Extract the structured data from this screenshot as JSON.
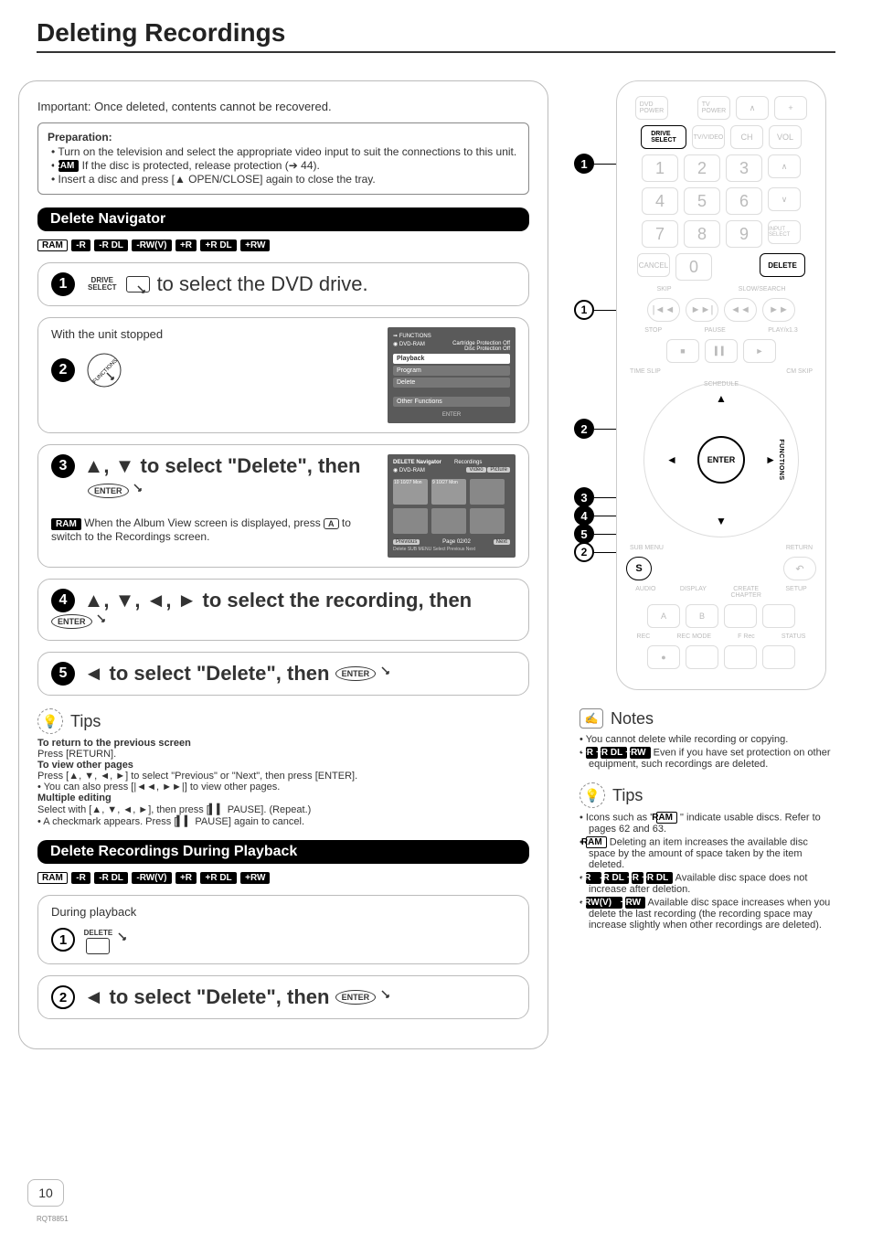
{
  "page": {
    "title": "Deleting Recordings",
    "number": "10",
    "doc_id": "RQT8851"
  },
  "intro": "Important: Once deleted, contents cannot be recovered.",
  "preparation": {
    "heading": "Preparation:",
    "items": [
      "Turn on the television and select the appropriate video input to suit the connections to this unit.",
      "If the disc is protected, release protection (➔ 44).",
      "Insert a disc and press [▲ OPEN/CLOSE] again to close the tray."
    ],
    "ram_chip": "RAM"
  },
  "section_delete_nav": {
    "title": "Delete Navigator",
    "chips": [
      "RAM",
      "-R",
      "-R DL",
      "-RW(V)",
      "+R",
      "+R DL",
      "+RW"
    ],
    "step1": {
      "drive_select_label": "DRIVE\nSELECT",
      "text": "to select the DVD drive."
    },
    "step2": {
      "text": "With the unit stopped",
      "screen": {
        "brand": "FUNCTIONS",
        "disc": "DVD-RAM",
        "info1": "Cartridge Protection  Off",
        "info2": "Disc Protection  Off",
        "items": [
          "Playback",
          "Program",
          "Delete",
          "Other Functions"
        ],
        "help": "ENTER"
      }
    },
    "step3": {
      "text1": "▲, ▼ to select \"Delete\", then",
      "enter": "ENTER",
      "ram": "RAM",
      "text2": " When the Album View screen is displayed, press ",
      "key_a": "A",
      "text3": " to switch to the Recordings screen.",
      "screen": {
        "title": "DELETE Navigator",
        "subtitle": "Recordings",
        "disc": "DVD-RAM",
        "tabs_video": "Video",
        "tabs_picture": "Picture",
        "thumb1": "10  10/27 Mon",
        "thumb2": "  9  10/27 Mon",
        "prev": "Previous",
        "page": "Page  02/02",
        "next": "Next",
        "hint": "Delete    SUB MENU    Select        Previous    Next"
      }
    },
    "step4": {
      "text": "▲, ▼, ◄, ► to select the recording, then ",
      "enter": "ENTER"
    },
    "step5": {
      "text": "◄ to select \"Delete\", then ",
      "enter": "ENTER"
    }
  },
  "tips_left": {
    "heading": "Tips",
    "return_h": "To return to the previous screen",
    "return_t": "Press [RETURN].",
    "pages_h": "To view other pages",
    "pages_t1": "Press [▲, ▼, ◄, ►] to select \"Previous\" or \"Next\", then press [ENTER].",
    "pages_t2": "• You can also press [|◄◄, ►►|] to view other pages.",
    "multi_h": "Multiple editing",
    "multi_t1": "Select with [▲, ▼, ◄, ►], then press [▍▍ PAUSE]. (Repeat.)",
    "multi_t2": "• A checkmark appears. Press [▍▍ PAUSE] again to cancel."
  },
  "section_playback": {
    "title": "Delete Recordings During Playback",
    "chips": [
      "RAM",
      "-R",
      "-R DL",
      "-RW(V)",
      "+R",
      "+R DL",
      "+RW"
    ],
    "step1": {
      "text": "During playback",
      "delete_label": "DELETE"
    },
    "step2": {
      "text": "◄ to select \"Delete\", then ",
      "enter": "ENTER"
    }
  },
  "remote": {
    "dvd_power": "DVD\nPOWER",
    "tv_power": "TV\nPOWER",
    "drive_select": "DRIVE\nSELECT",
    "tvvideo": "TV/VIDEO",
    "ch": "CH",
    "vol": "VOL",
    "nums": [
      "1",
      "2",
      "3",
      "4",
      "5",
      "6",
      "7",
      "8",
      "9",
      "0"
    ],
    "input_select": "INPUT SELECT",
    "cancel": "CANCEL",
    "delete": "DELETE",
    "skip": "SKIP",
    "slow": "SLOW/SEARCH",
    "stop": "STOP",
    "pause": "PAUSE",
    "play": "PLAY/x1.3",
    "time_slip": "TIME SLIP",
    "cm_skip": "CM SKIP",
    "enter": "ENTER",
    "schedule": "SCHEDULE",
    "functions": "FUNCTIONS",
    "sub_menu": "SUB MENU",
    "return": "RETURN",
    "s": "S",
    "audio": "AUDIO",
    "display": "DISPLAY",
    "create_chapter": "CREATE\nCHAPTER",
    "setup": "SETUP",
    "a": "A",
    "b": "B",
    "rec": "REC",
    "rec_mode": "REC MODE",
    "f_rec": "F Rec",
    "status": "STATUS"
  },
  "notes": {
    "heading": "Notes",
    "n1": "You cannot delete while recording or copying.",
    "n2_chips": [
      "+R",
      "+R DL",
      "+RW"
    ],
    "n2": " Even if you have set protection on other equipment, such recordings are deleted."
  },
  "tips_right": {
    "heading": "Tips",
    "t1a": "Icons such as \" ",
    "t1_chip": "RAM",
    "t1b": " \" indicate usable discs. Refer to pages 62 and 63.",
    "t2_chip": "RAM",
    "t2": " Deleting an item increases the available disc space by the amount of space taken by the item deleted.",
    "t3_chips": [
      "-R",
      "-R DL",
      "+R",
      "+R DL"
    ],
    "t3": " Available disc space does not increase after deletion.",
    "t4_chips": [
      "-RW(V)",
      "+RW"
    ],
    "t4": " Available disc space increases when you delete the last recording (the recording space may increase slightly when other recordings are deleted)."
  }
}
